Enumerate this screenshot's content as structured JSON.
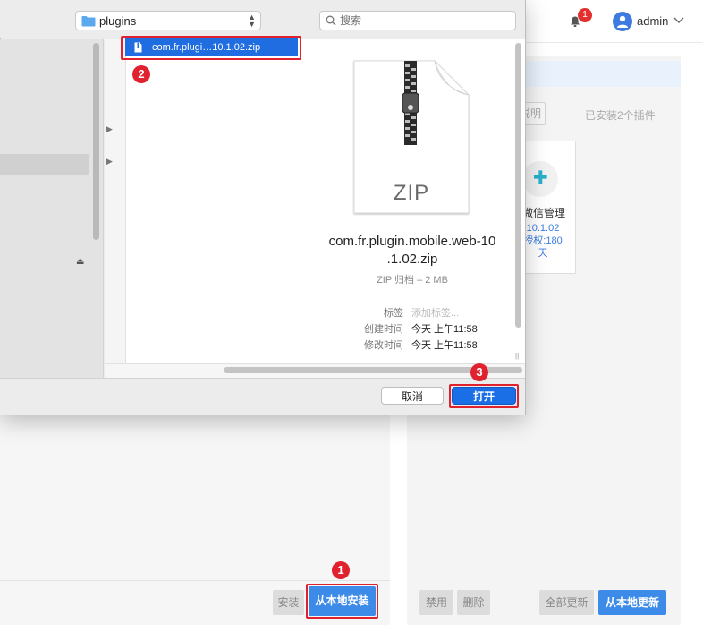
{
  "app": {
    "header": {
      "notification_count": "1",
      "user_name": "admin"
    },
    "plugin_panel": {
      "desc_button": "说明",
      "installed_count_text": "已安装2个插件",
      "plugin_card": {
        "name": "微信管理",
        "version": "10.1.02",
        "license_line": "授权:180",
        "license_unit": "天"
      }
    },
    "left_footer": {
      "install_button": "安装",
      "install_local_button": "从本地安装"
    },
    "right_footer": {
      "disable_button": "禁用",
      "delete_button": "删除",
      "update_all_button": "全部更新",
      "update_local_button": "从本地更新"
    }
  },
  "dialog": {
    "folder": "plugins",
    "search_placeholder": "搜索",
    "selected_file": "com.fr.plugi…10.1.02.zip",
    "preview": {
      "icon_label": "ZIP",
      "file_name_line1": "com.fr.plugin.mobile.web-10",
      "file_name_line2": ".1.02.zip",
      "kind_size": "ZIP 归档 – 2 MB",
      "tags_label": "标签",
      "tags_placeholder": "添加标签...",
      "created_label": "创建时间",
      "created_value": "今天 上午11:58",
      "modified_label": "修改时间",
      "modified_value": "今天 上午11:58"
    },
    "cancel_button": "取消",
    "open_button": "打开"
  },
  "annotations": {
    "step1": "1",
    "step2": "2",
    "step3": "3"
  },
  "colors": {
    "highlight": "#e0212e",
    "accent_blue": "#3d8be8",
    "selection_blue": "#1f6de0"
  }
}
